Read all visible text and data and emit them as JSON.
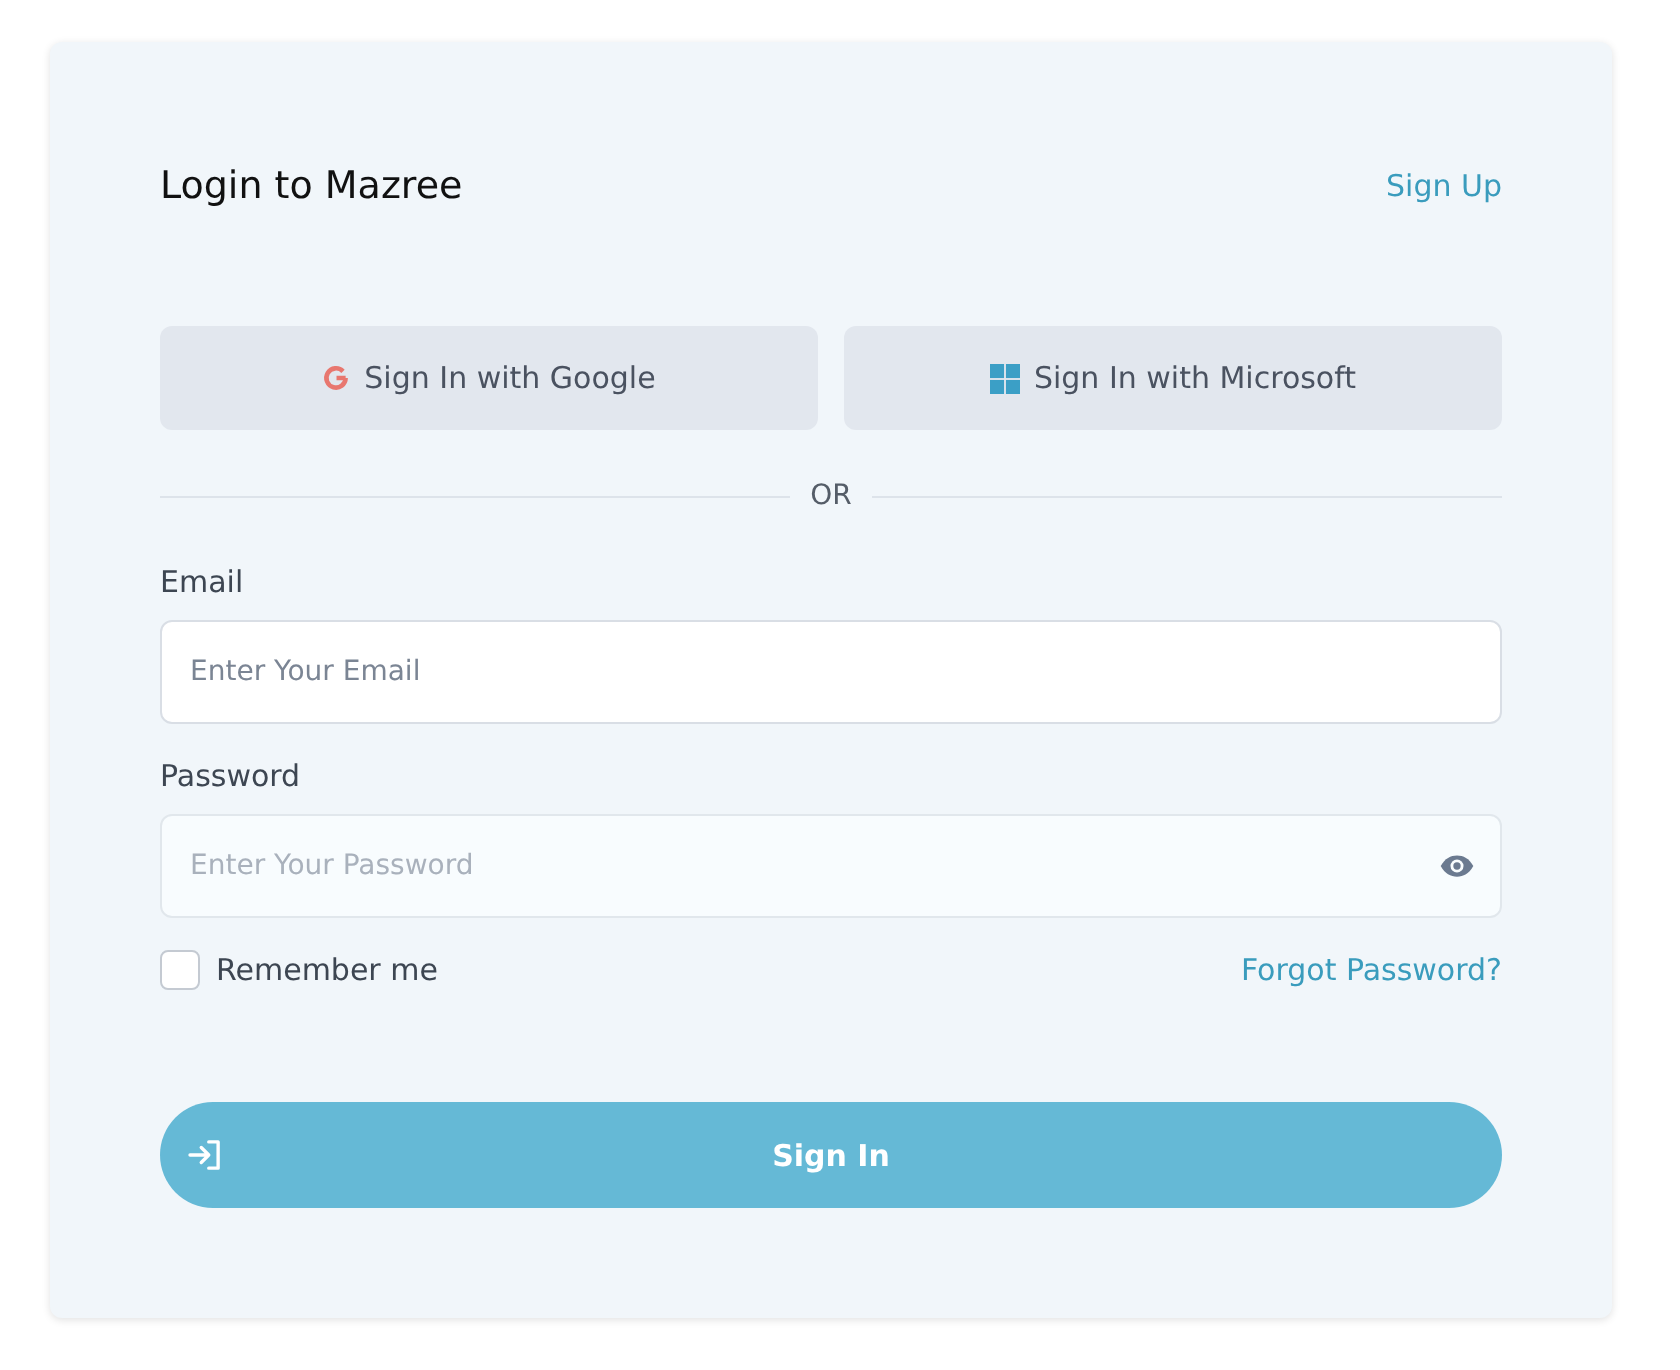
{
  "header": {
    "title": "Login to Mazree",
    "link": "Sign Up"
  },
  "social_buttons": [
    {
      "kind": "google",
      "label": "Sign In with Google"
    },
    {
      "kind": "microsoft",
      "label": "Sign In with Microsoft"
    }
  ],
  "divider": {
    "label": "OR"
  },
  "fields": [
    {
      "kind": "email",
      "label": "Email",
      "placeholder": "Enter Your Email"
    },
    {
      "kind": "password",
      "label": "Password",
      "placeholder": "Enter Your Password"
    }
  ],
  "remember": {
    "label": "Remember me",
    "checked": false
  },
  "forgot_link": "Forgot Password?",
  "submit": {
    "label": "Sign In"
  }
}
